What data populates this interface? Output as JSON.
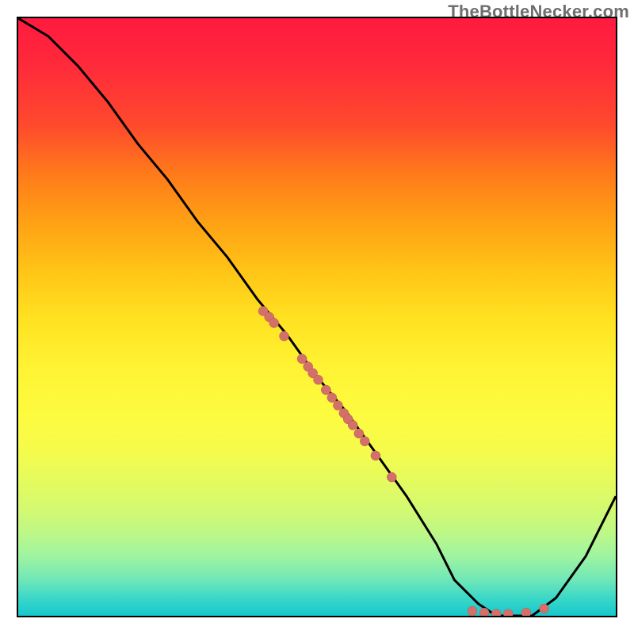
{
  "watermark": "TheBottleNecker.com",
  "colors": {
    "gradient_top": "#ff1a3f",
    "gradient_bottom": "#16c8cc",
    "curve": "#000000",
    "dot_fill": "#d4706a",
    "dot_stroke": "#b95a54"
  },
  "chart_data": {
    "type": "line",
    "title": "",
    "xlabel": "",
    "ylabel": "",
    "xlim": [
      0,
      100
    ],
    "ylim": [
      0,
      100
    ],
    "grid": false,
    "legend": false,
    "series": [
      {
        "name": "curve",
        "x": [
          0,
          5,
          10,
          15,
          20,
          25,
          30,
          35,
          40,
          45,
          50,
          55,
          60,
          65,
          70,
          73,
          77,
          80,
          83,
          86,
          90,
          95,
          100
        ],
        "y": [
          100,
          97,
          92,
          86,
          79,
          73,
          66,
          60,
          53,
          47,
          40,
          34,
          27,
          20,
          12,
          6,
          2,
          0,
          0,
          0,
          3,
          10,
          20
        ]
      }
    ],
    "points": [
      {
        "x": 41,
        "y": 51
      },
      {
        "x": 42,
        "y": 50
      },
      {
        "x": 42.8,
        "y": 49
      },
      {
        "x": 44.5,
        "y": 46.8
      },
      {
        "x": 47.5,
        "y": 43
      },
      {
        "x": 48.5,
        "y": 41.7
      },
      {
        "x": 49.3,
        "y": 40.6
      },
      {
        "x": 50.2,
        "y": 39.5
      },
      {
        "x": 51.5,
        "y": 37.8
      },
      {
        "x": 52.5,
        "y": 36.5
      },
      {
        "x": 53.5,
        "y": 35.2
      },
      {
        "x": 54.5,
        "y": 33.9
      },
      {
        "x": 55.2,
        "y": 32.9
      },
      {
        "x": 56.0,
        "y": 31.9
      },
      {
        "x": 57.0,
        "y": 30.5
      },
      {
        "x": 58.0,
        "y": 29.2
      },
      {
        "x": 59.8,
        "y": 26.8
      },
      {
        "x": 62.5,
        "y": 23.2
      },
      {
        "x": 76.0,
        "y": 0.8
      },
      {
        "x": 78.0,
        "y": 0.5
      },
      {
        "x": 80.0,
        "y": 0.3
      },
      {
        "x": 82.0,
        "y": 0.3
      },
      {
        "x": 85.0,
        "y": 0.5
      },
      {
        "x": 88.0,
        "y": 1.2
      }
    ],
    "point_radius_px": 6
  }
}
